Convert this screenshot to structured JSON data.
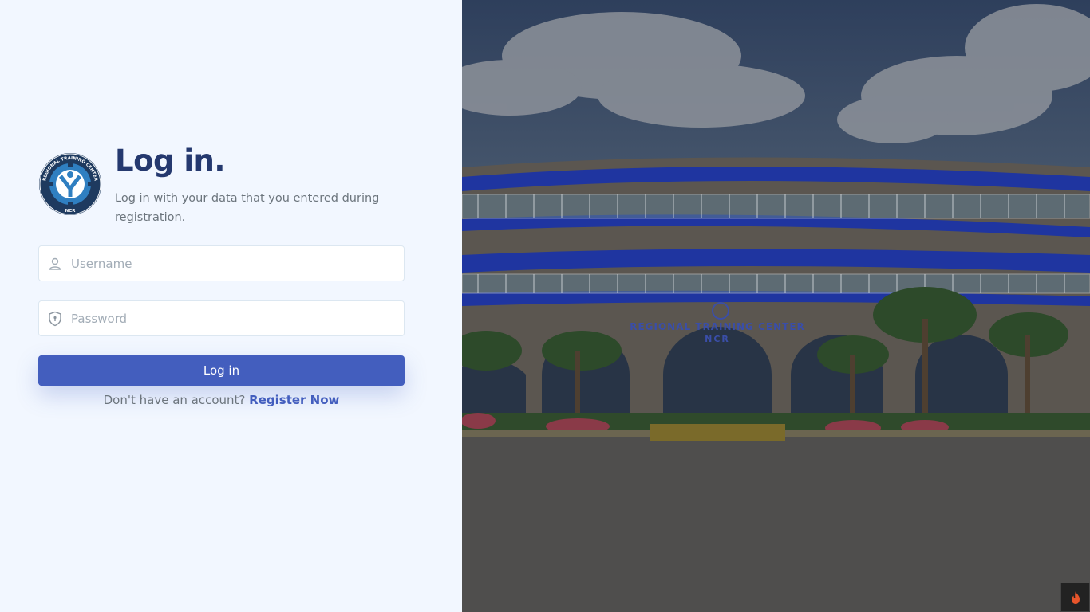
{
  "logo": {
    "ring_text_top": "REGIONAL TRAINING CENTER",
    "ring_text_bottom": "NCR"
  },
  "header": {
    "title": "Log in.",
    "subtitle": "Log in with your data that you entered during registration."
  },
  "form": {
    "username_placeholder": "Username",
    "password_placeholder": "Password",
    "login_label": "Log in"
  },
  "footer": {
    "prompt": "Don't have an account?",
    "register_label": "Register Now"
  },
  "hero": {
    "building_sign": "REGIONAL TRAINING CENTER",
    "building_sign_sub": "NCR"
  },
  "colors": {
    "primary": "#435ebe",
    "title": "#25396f",
    "panel_bg": "#f2f7ff"
  },
  "icons": {
    "username": "user-icon",
    "password": "shield-icon",
    "fab": "fire-icon"
  }
}
